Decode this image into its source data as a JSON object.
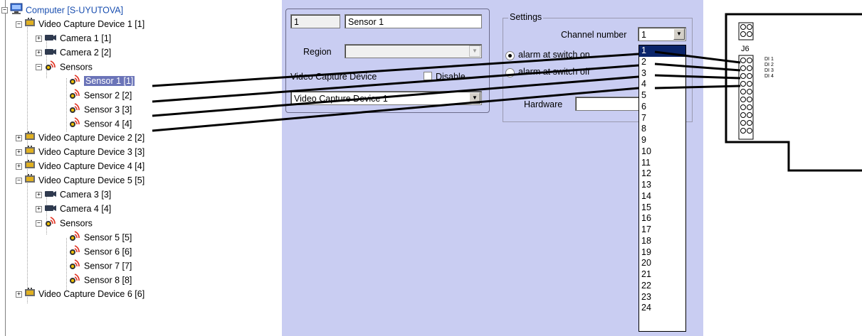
{
  "tree": {
    "computer": "Computer [S-UYUTOVA]",
    "nodes": [
      {
        "label": "Video Capture Device 1 [1]",
        "kind": "device"
      },
      {
        "label": "Camera 1 [1]",
        "kind": "camera"
      },
      {
        "label": "Camera 2 [2]",
        "kind": "camera"
      },
      {
        "label": "Sensors",
        "kind": "sensors"
      },
      {
        "label": "Sensor 1 [1]",
        "kind": "sensor"
      },
      {
        "label": "Sensor 2 [2]",
        "kind": "sensor"
      },
      {
        "label": "Sensor 3 [3]",
        "kind": "sensor"
      },
      {
        "label": "Sensor 4 [4]",
        "kind": "sensor"
      },
      {
        "label": "Video Capture Device 2 [2]",
        "kind": "device"
      },
      {
        "label": "Video Capture Device 3 [3]",
        "kind": "device"
      },
      {
        "label": "Video Capture Device 4 [4]",
        "kind": "device"
      },
      {
        "label": "Video Capture Device 5 [5]",
        "kind": "device"
      },
      {
        "label": "Camera 3 [3]",
        "kind": "camera"
      },
      {
        "label": "Camera 4 [4]",
        "kind": "camera"
      },
      {
        "label": "Sensors",
        "kind": "sensors"
      },
      {
        "label": "Sensor 5 [5]",
        "kind": "sensor"
      },
      {
        "label": "Sensor 6 [6]",
        "kind": "sensor"
      },
      {
        "label": "Sensor 7 [7]",
        "kind": "sensor"
      },
      {
        "label": "Sensor 8 [8]",
        "kind": "sensor"
      },
      {
        "label": "Video Capture Device 6 [6]",
        "kind": "device"
      }
    ]
  },
  "panel": {
    "id_value": "1",
    "name_value": "Sensor 1",
    "region_label": "Region",
    "region_value": "",
    "vcd_label": "Video Capture Device",
    "disable_label": "Disable",
    "vcd_value": "Video Capture Device 1",
    "settings_title": "Settings",
    "channel_label": "Channel number",
    "channel_value": "1",
    "alarm_on_label": "alarm at switch on",
    "alarm_off_label": "alarm at switch off",
    "hardware_label": "Hardware",
    "channel_options": [
      "1",
      "2",
      "3",
      "4",
      "5",
      "6",
      "7",
      "8",
      "9",
      "10",
      "11",
      "12",
      "13",
      "14",
      "15",
      "16",
      "17",
      "18",
      "19",
      "20",
      "21",
      "22",
      "23",
      "24"
    ]
  },
  "board": {
    "connector": "J6",
    "pins": [
      "DI 1",
      "DI 2",
      "DI 3",
      "DI 4"
    ]
  },
  "colors": {
    "panel_bg": "#c9cdf2",
    "selection": "#0a246a",
    "tree_selection": "#6b74b8"
  }
}
